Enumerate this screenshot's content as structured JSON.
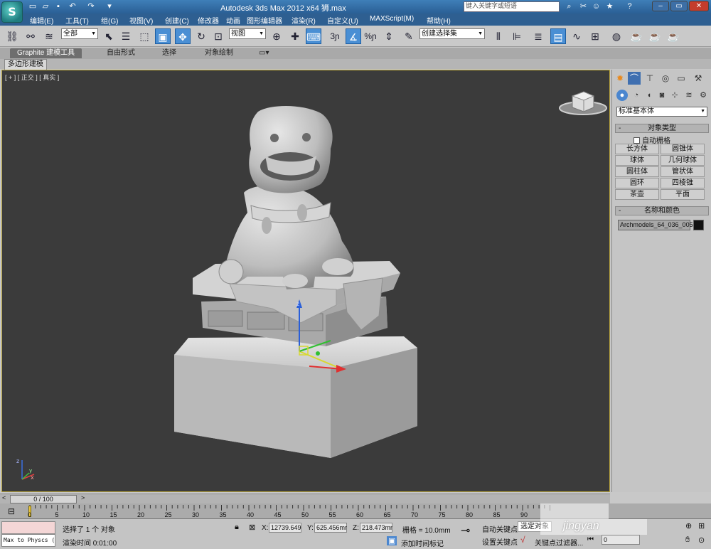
{
  "app": {
    "title": "Autodesk 3ds Max  2012 x64    狮.max",
    "search_placeholder": "键入关键字或短语"
  },
  "menu": [
    "编辑(E)",
    "工具(T)",
    "组(G)",
    "视图(V)",
    "创建(C)",
    "修改器",
    "动画",
    "图形编辑器",
    "渲染(R)",
    "自定义(U)",
    "MAXScript(M)",
    "帮助(H)"
  ],
  "toolbar": {
    "selection_filter": "全部",
    "reference_coord": "视图",
    "named_selection": "创建选择集",
    "snap_3": "3",
    "snap_percent": "%"
  },
  "ribbon": {
    "tabs": [
      "Graphite 建模工具",
      "自由形式",
      "选择",
      "对象绘制"
    ],
    "subtab": "多边形建模"
  },
  "viewport": {
    "label": "[ + ] [ 正交 ] [ 真实 ]",
    "gizmo_x": "x",
    "gizmo_y": "y",
    "gizmo_z": "z"
  },
  "command_panel": {
    "category": "标准基本体",
    "object_type_title": "对象类型",
    "autogrid_label": "自动栅格",
    "object_buttons": [
      "长方体",
      "圆锥体",
      "球体",
      "几何球体",
      "圆柱体",
      "管状体",
      "圆环",
      "四棱锥",
      "茶壶",
      "平面"
    ],
    "name_color_title": "名称和颜色",
    "object_name": "Archmodels_64_036_005"
  },
  "timeline": {
    "frame_display": "0 / 100",
    "ticks": [
      "0",
      "5",
      "10",
      "15",
      "20",
      "25",
      "30",
      "35",
      "40",
      "45",
      "50",
      "55",
      "60",
      "65",
      "70",
      "75",
      "80",
      "85",
      "90"
    ]
  },
  "status": {
    "maxscript_text": "Max to Physcs (",
    "selection_text": "选择了 1 个 对象",
    "render_time": "渲染时间  0:01:00",
    "x_label": "X:",
    "x_value": "12739.649",
    "y_label": "Y:",
    "y_value": "625.456mr",
    "z_label": "Z:",
    "z_value": "218.473mr",
    "grid": "栅格 = 10.0mm",
    "add_time_tag": "添加时间标记",
    "auto_key": "自动关键点",
    "set_key": "设置关键点",
    "selected_label": "选定对象",
    "key_filters": "关键点过滤器...",
    "frame_input": "0"
  },
  "watermark": "jingyan"
}
